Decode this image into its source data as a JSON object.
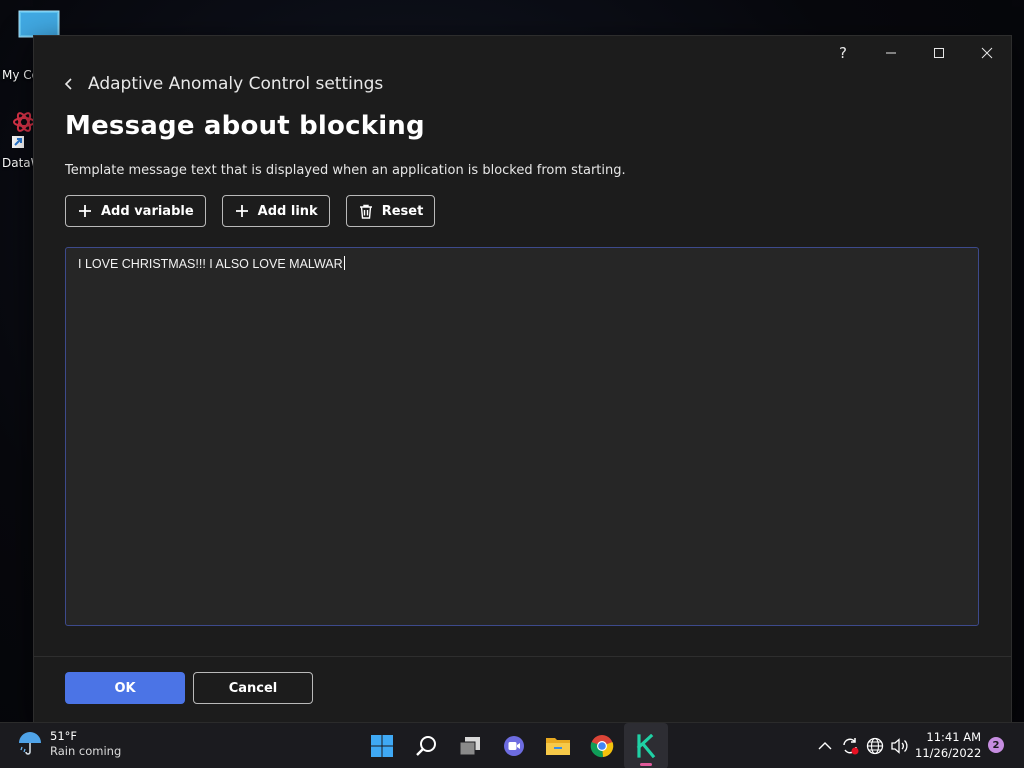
{
  "desktop": {
    "icons": [
      {
        "label": "My Co"
      },
      {
        "label": "DataW"
      }
    ]
  },
  "window": {
    "controls": {
      "help": "?"
    },
    "breadcrumb": "Adaptive Anomaly Control settings",
    "title": "Message about blocking",
    "description": "Template message text that is displayed when an application is blocked from starting.",
    "toolbar": {
      "add_variable": "Add variable",
      "add_link": "Add link",
      "reset": "Reset"
    },
    "editor_value": "I LOVE CHRISTMAS!!! I ALSO LOVE MALWAR",
    "footer": {
      "ok": "OK",
      "cancel": "Cancel"
    },
    "accent_color": "#4b74e6"
  },
  "taskbar": {
    "weather": {
      "temp": "51°F",
      "condition": "Rain coming"
    },
    "clock": {
      "time": "11:41 AM",
      "date": "11/26/2022"
    },
    "notifications": "2",
    "pinned": [
      "start-icon",
      "search-icon",
      "task-view-icon",
      "chat-icon",
      "file-explorer-icon",
      "chrome-icon",
      "kaspersky-icon"
    ],
    "tray": [
      "chevron-up-icon",
      "sync-icon",
      "globe-icon",
      "volume-icon"
    ]
  }
}
